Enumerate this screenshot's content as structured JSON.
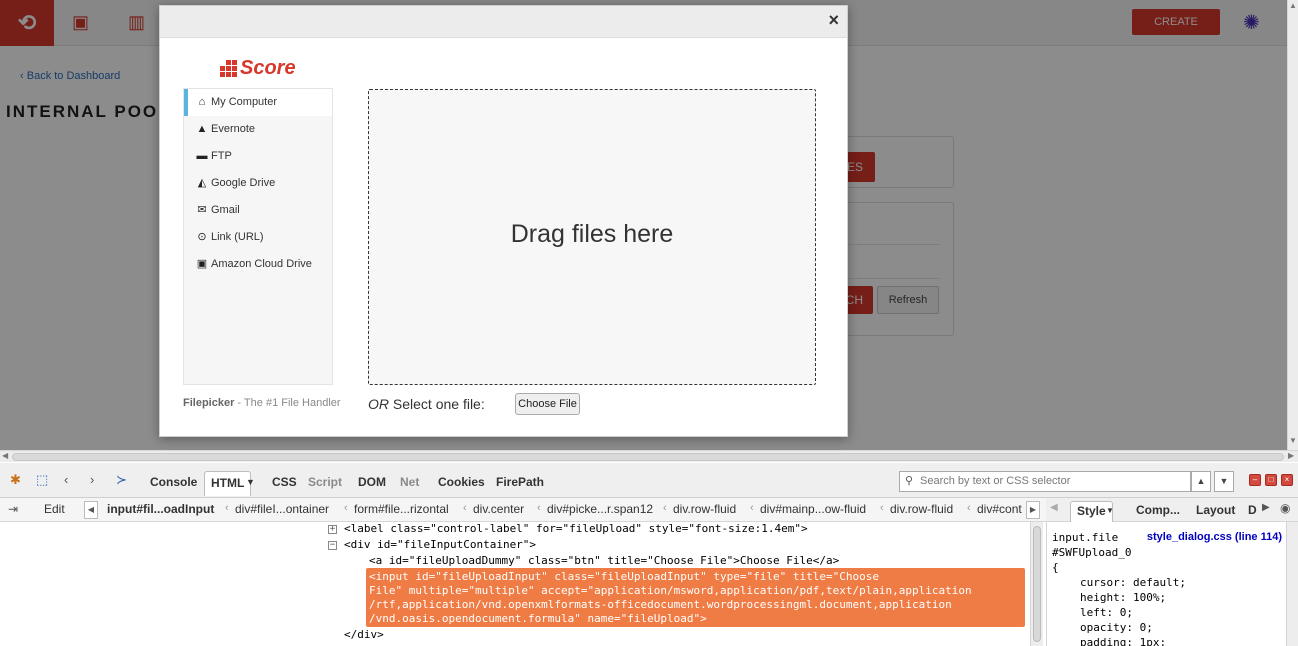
{
  "app": {
    "create_label": "CREATE",
    "back_link": "Back to Dashboard",
    "page_heading": "INTERNAL POOL",
    "bg_button_partial": "ES",
    "bg_button2_partial": "CH",
    "refresh_label": "Refresh"
  },
  "modal": {
    "close_icon": "×",
    "brand_name": "Score",
    "sources": [
      {
        "label": "My Computer",
        "icon": "home-icon",
        "glyph": "⌂",
        "active": true
      },
      {
        "label": "Evernote",
        "icon": "evernote-icon",
        "glyph": "▲"
      },
      {
        "label": "FTP",
        "icon": "ftp-icon",
        "glyph": "▬"
      },
      {
        "label": "Google Drive",
        "icon": "google-drive-icon",
        "glyph": "◭"
      },
      {
        "label": "Gmail",
        "icon": "gmail-icon",
        "glyph": "✉"
      },
      {
        "label": "Link (URL)",
        "icon": "link-icon",
        "glyph": "⊙"
      },
      {
        "label": "Amazon Cloud Drive",
        "icon": "amazon-cloud-drive-icon",
        "glyph": "▣"
      }
    ],
    "filepicker_name": "Filepicker",
    "filepicker_tagline": " - The #1 File Handler",
    "drop_text": "Drag files here",
    "or_text": "OR",
    "select_text": " Select one file:",
    "choose_file_label": "Choose File"
  },
  "devtools": {
    "tabs": [
      "Console",
      "HTML",
      "CSS",
      "Script",
      "DOM",
      "Net",
      "Cookies",
      "FirePath"
    ],
    "active_tab": "HTML",
    "dim_tabs": [
      "Script",
      "Net"
    ],
    "search_placeholder": "Search by text or CSS selector",
    "edit_label": "Edit",
    "breadcrumbs": [
      "input#fil...oadInput",
      "div#fileI...ontainer",
      "form#file...rizontal",
      "div.center",
      "div#picke...r.span12",
      "div.row-fluid",
      "div#mainp...ow-fluid",
      "div.row-fluid",
      "div#cont"
    ],
    "side_tabs": [
      "Style",
      "Comp...",
      "Layout",
      "D"
    ],
    "html_lines": {
      "label_line": "<label class=\"control-label\" for=\"fileUpload\" style=\"font-size:1.4em\">",
      "div_line": "<div id=\"fileInputContainer\">",
      "a_line": "<a id=\"fileUploadDummy\" class=\"btn\" title=\"Choose File\">Choose File</a>",
      "selected": [
        "<input id=\"fileUploadInput\" class=\"fileUploadInput\" type=\"file\" title=\"Choose",
        "File\" multiple=\"multiple\" accept=\"application/msword,application/pdf,text/plain,application",
        "/rtf,application/vnd.openxmlformats-officedocument.wordprocessingml.document,application",
        "/vnd.oasis.opendocument.formula\" name=\"fileUpload\">"
      ],
      "close_div": "</div>"
    },
    "style_panel": {
      "selector_line1": "input.file",
      "selector_overlap": "style_dialog.css (line 114)",
      "selector_line2": "#SWFUpload_0",
      "open_brace": "{",
      "rules": [
        "cursor: default;",
        "height: 100%;",
        "left: 0;",
        "opacity: 0;",
        "padding: 1px;"
      ]
    }
  }
}
